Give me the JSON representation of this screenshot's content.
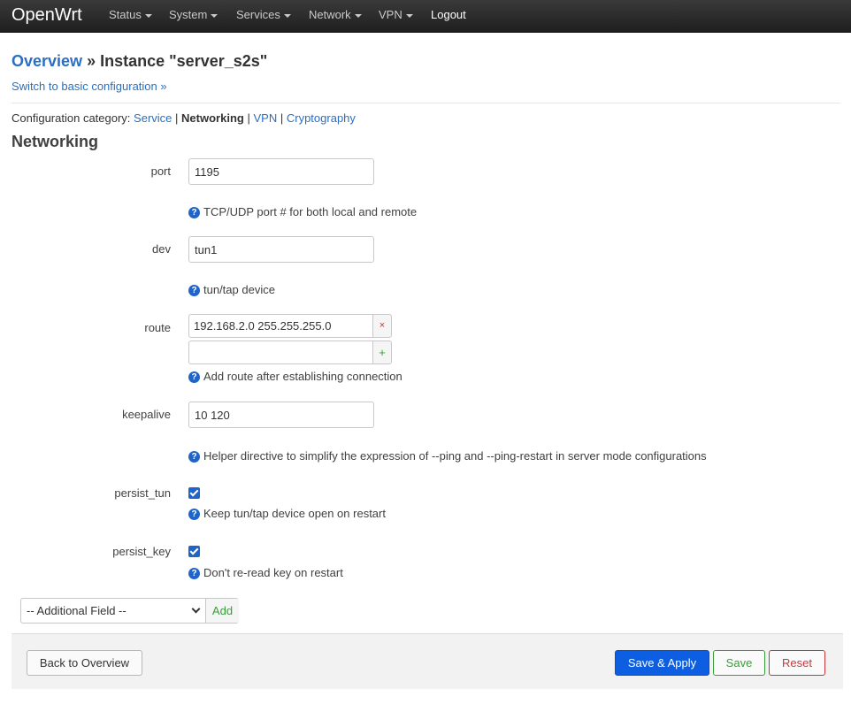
{
  "navbar": {
    "brand": "OpenWrt",
    "menu": [
      {
        "label": "Status"
      },
      {
        "label": "System"
      },
      {
        "label": "Services"
      },
      {
        "label": "Network"
      },
      {
        "label": "VPN"
      }
    ],
    "logout": "Logout"
  },
  "header": {
    "overview_link": "Overview",
    "separator": "»",
    "instance_title": "Instance \"server_s2s\"",
    "switch_link": "Switch to basic configuration »"
  },
  "category": {
    "prefix": "Configuration category:",
    "items": [
      {
        "label": "Service"
      },
      {
        "label": "Networking"
      },
      {
        "label": "VPN"
      },
      {
        "label": "Cryptography"
      }
    ],
    "active": "Networking",
    "divider": "|"
  },
  "section": {
    "title": "Networking"
  },
  "fields": {
    "port": {
      "label": "port",
      "value": "1195",
      "help": "TCP/UDP port # for both local and remote"
    },
    "dev": {
      "label": "dev",
      "value": "tun1",
      "help": "tun/tap device"
    },
    "route": {
      "label": "route",
      "entries": [
        "192.168.2.0 255.255.255.0"
      ],
      "new_entry": "",
      "remove_symbol": "×",
      "add_symbol": "+",
      "help": "Add route after establishing connection"
    },
    "keepalive": {
      "label": "keepalive",
      "value": "10 120",
      "help": "Helper directive to simplify the expression of --ping and --ping-restart in server mode configurations"
    },
    "persist_tun": {
      "label": "persist_tun",
      "checked": true,
      "help": "Keep tun/tap device open on restart"
    },
    "persist_key": {
      "label": "persist_key",
      "checked": true,
      "help": "Don't re-read key on restart"
    }
  },
  "help_icon_glyph": "?",
  "additional_field": {
    "selected": "-- Additional Field --",
    "add_label": "Add"
  },
  "footer": {
    "back": "Back to Overview",
    "save_apply": "Save & Apply",
    "save": "Save",
    "reset": "Reset"
  },
  "colors": {
    "navbar_bg": "#2b2b2b",
    "link": "#2a6fc2",
    "primary": "#0d5ee0",
    "success": "#3a9c3a",
    "danger": "#c9363a",
    "help_icon": "#1f64c8"
  },
  "icons": {
    "help": "question-circle-icon",
    "dropdown": "caret-down-icon",
    "remove": "times-icon",
    "add": "plus-icon",
    "checkbox": "checkmark-icon"
  }
}
